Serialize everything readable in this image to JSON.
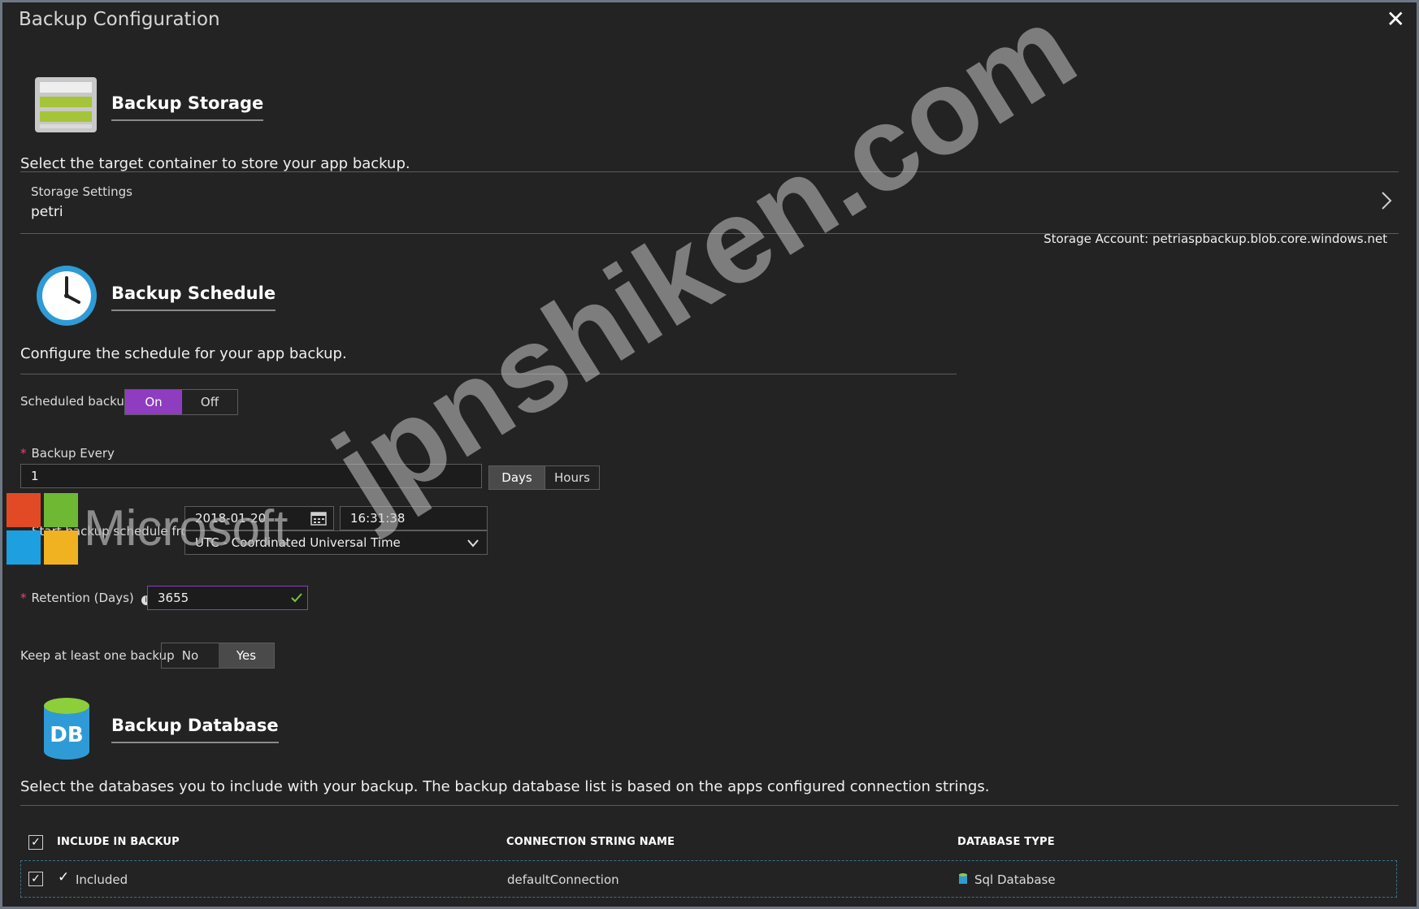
{
  "window": {
    "title": "Backup Configuration",
    "close_glyph": "✕"
  },
  "storage": {
    "heading": "Backup Storage",
    "description": "Select the target container to store your app backup.",
    "settings_label": "Storage Settings",
    "settings_value": "petri",
    "account_text": "Storage Account: petriaspbackup.blob.core.windows.net",
    "icon": "storage-icon"
  },
  "schedule": {
    "heading": "Backup Schedule",
    "description": "Configure the schedule for your app backup.",
    "scheduled_backup_label": "Scheduled backup",
    "toggle_on": "On",
    "toggle_off": "Off",
    "selected": "On",
    "backup_every_label": "Backup Every",
    "backup_every_value": "1",
    "unit_days": "Days",
    "unit_hours": "Hours",
    "selected_unit": "Days",
    "start_label": "Start backup schedule from",
    "start_date": "2018-01-20",
    "start_time": "16:31:38",
    "timezone": "UTC - Coordinated Universal Time",
    "retention_label": "Retention (Days)",
    "retention_value": "3655",
    "keep_label": "Keep at least one backup",
    "keep_no": "No",
    "keep_yes": "Yes",
    "keep_selected": "Yes",
    "icon": "clock-icon"
  },
  "database": {
    "heading": "Backup Database",
    "description": "Select the databases you to include with your backup. The backup database list is based on the apps configured connection strings.",
    "icon_text": "DB",
    "columns": [
      "INCLUDE IN BACKUP",
      "CONNECTION STRING NAME",
      "DATABASE TYPE"
    ],
    "rows": [
      {
        "included": "Included",
        "connection": "defaultConnection",
        "type": "Sql Database"
      }
    ]
  },
  "overlay": {
    "watermark": "jpnshiken.com",
    "ms_logo_text": "Microsoft"
  },
  "colors": {
    "accent_purple": "#8e3dc1",
    "background": "#232323",
    "valid_green": "#7cc53a"
  }
}
